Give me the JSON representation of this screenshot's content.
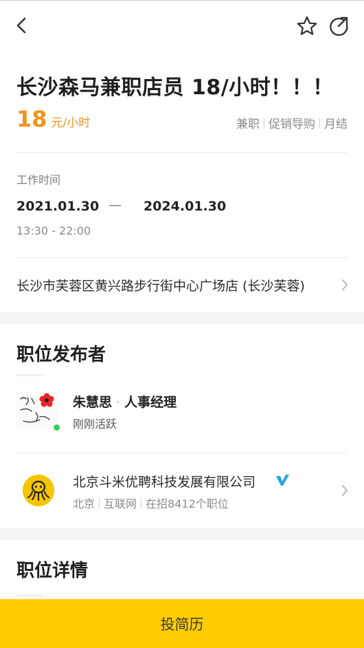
{
  "header": {
    "back_icon": "chevron-left-icon",
    "favorite_icon": "star-icon",
    "share_icon": "share-icon"
  },
  "job": {
    "title": "长沙森马兼职店员 18/小时！！！",
    "salary_amount": "18",
    "salary_unit": "元/小时",
    "tags": [
      "兼职",
      "促销导购",
      "月结"
    ],
    "accent_color": "#f0951a"
  },
  "work_time": {
    "label": "工作时间",
    "start_date": "2021.01.30",
    "dash": "—",
    "end_date": "2024.01.30",
    "hours": "13:30 - 22:00"
  },
  "location": {
    "address": "长沙市芙蓉区黄兴路步行街中心广场店 (长沙芙蓉)"
  },
  "publisher": {
    "section_title": "职位发布者",
    "name": "朱慧思",
    "dot": "·",
    "role": "人事经理",
    "status": "刚刚活跃",
    "online_color": "#2ed158"
  },
  "company": {
    "name": "北京斗米优聘科技发展有限公司",
    "verified_icon": "verified-v-icon",
    "meta": [
      "北京",
      "互联网",
      "在招8412个职位"
    ]
  },
  "details": {
    "section_title": "职位详情"
  },
  "apply": {
    "label": "投简历",
    "color": "#fecc00"
  }
}
